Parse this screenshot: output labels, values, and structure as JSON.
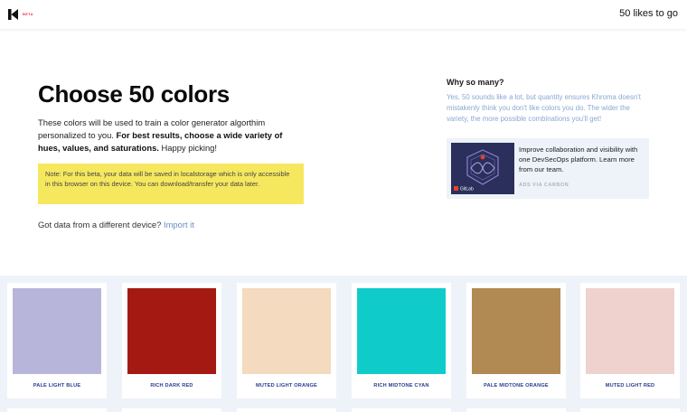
{
  "header": {
    "beta_label": "BETA",
    "likes_to_go": "50 likes to go"
  },
  "main": {
    "title": "Choose 50 colors",
    "intro_plain": "These colors will be used to train a color generator algorthim personalized to you. ",
    "intro_bold": "For best results, choose a wide variety of hues, values, and saturations.",
    "intro_tail": " Happy picking!",
    "note": "Note: For this beta, your data will be saved in localstorage which is only accessible in this browser on this device. You can download/transfer your data later.",
    "import_prompt": "Got data from a different device?",
    "import_link": "Import it"
  },
  "sidebar": {
    "why_title": "Why so many?",
    "why_text": "Yes, 50 sounds like a lot, but quantity ensures Khroma doesn't mistakenly think you don't like colors you do. The wider the variety, the more possible combinations you'll get!"
  },
  "ad": {
    "text": "Improve collaboration and visibility with one DevSecOps platform. Learn more from our team.",
    "via": "ADS VIA CARBON",
    "brand": "GitLab"
  },
  "colors": [
    {
      "name": "PALE LIGHT BLUE",
      "hex": "#b8b5da"
    },
    {
      "name": "RICH DARK RED",
      "hex": "#a41a13"
    },
    {
      "name": "MUTED LIGHT ORANGE",
      "hex": "#f4dabe"
    },
    {
      "name": "RICH MIDTONE CYAN",
      "hex": "#0fcccb"
    },
    {
      "name": "PALE MIDTONE ORANGE",
      "hex": "#b08a52"
    },
    {
      "name": "MUTED LIGHT RED",
      "hex": "#efd1cd"
    }
  ],
  "theme": {
    "note_bg": "#f6e85e",
    "link": "#6a8bc9",
    "label_color": "#2a3b8c",
    "palette_bg": "#eef3f9"
  }
}
